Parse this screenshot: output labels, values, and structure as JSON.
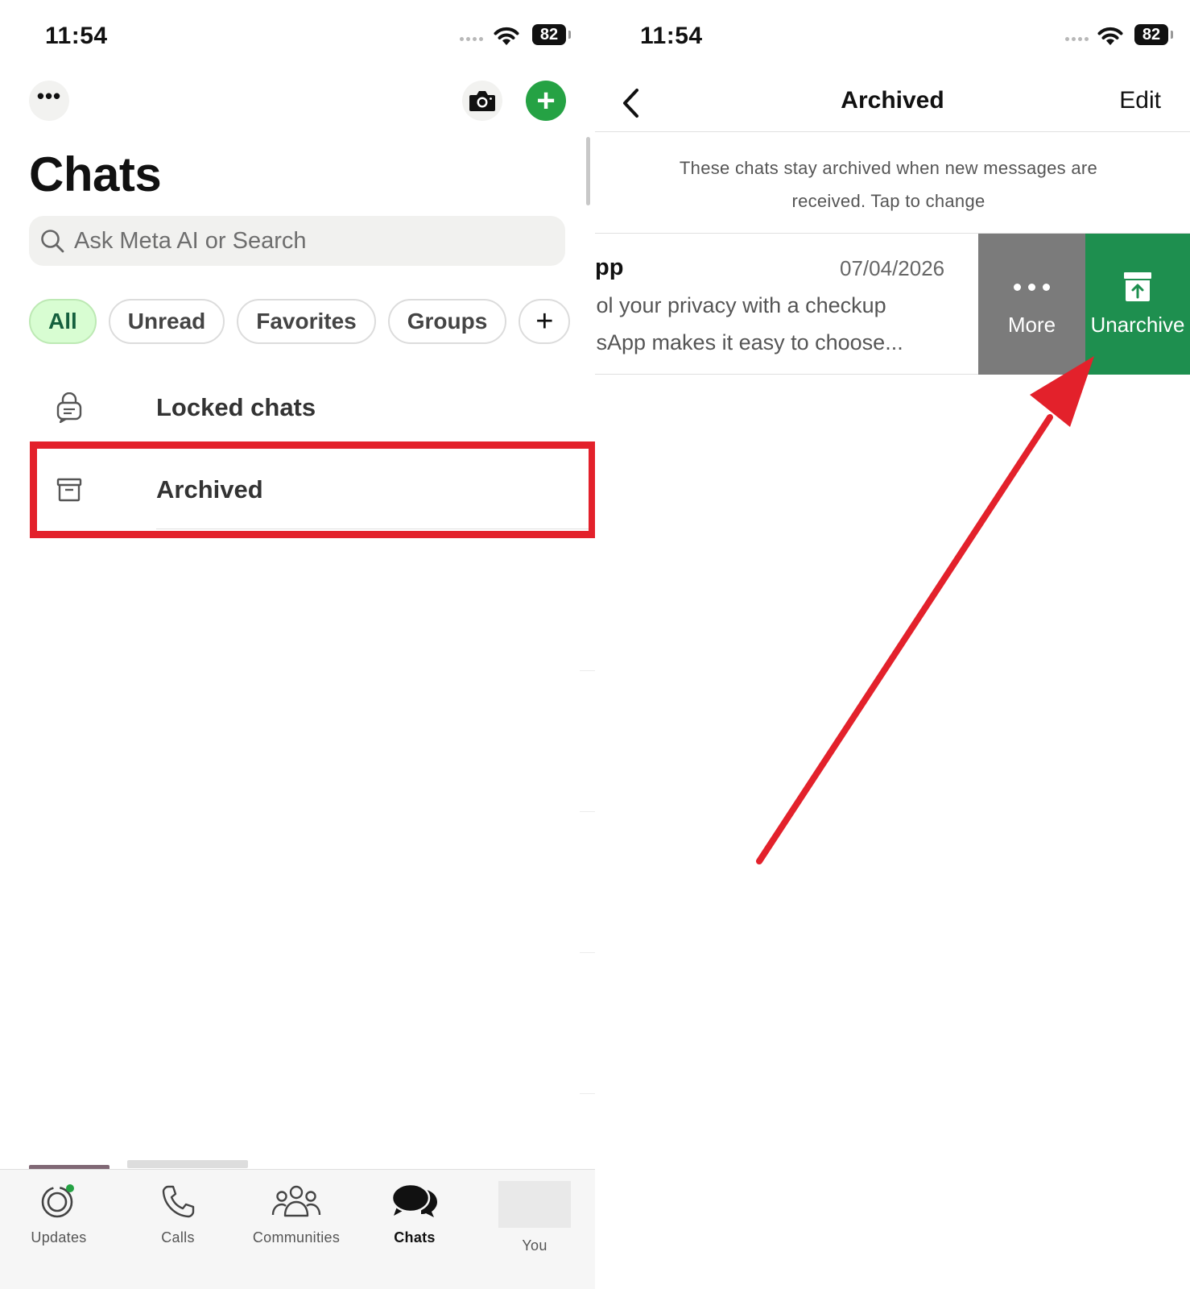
{
  "left_screen": {
    "status_bar": {
      "time": "11:54",
      "battery": "82"
    },
    "header": {
      "more_icon": "ellipsis-icon",
      "more_label": "•••",
      "camera_icon": "camera-icon",
      "new_chat_icon": "plus-icon",
      "new_chat_label": "+"
    },
    "title": "Chats",
    "search": {
      "placeholder": "Ask Meta AI or Search",
      "icon": "search-icon"
    },
    "filters": [
      "All",
      "Unread",
      "Favorites",
      "Groups"
    ],
    "filter_active": "All",
    "filter_add_label": "+",
    "rows": {
      "locked": {
        "label": "Locked chats",
        "icon": "locked-chat-icon"
      },
      "archived": {
        "label": "Archived",
        "icon": "archive-box-icon"
      }
    },
    "tabbar": {
      "tabs": [
        {
          "label": "Updates",
          "icon": "updates-icon"
        },
        {
          "label": "Calls",
          "icon": "phone-icon"
        },
        {
          "label": "Communities",
          "icon": "communities-icon"
        },
        {
          "label": "Chats",
          "icon": "chats-icon"
        },
        {
          "label": "You",
          "icon": "avatar"
        }
      ],
      "active": "Chats"
    }
  },
  "right_screen": {
    "status_bar": {
      "time": "11:54",
      "battery": "82"
    },
    "nav": {
      "back_icon": "chevron-left-icon",
      "title": "Archived",
      "edit_label": "Edit"
    },
    "notice_line1": "These chats stay archived when new messages are",
    "notice_line2": "received. Tap to change",
    "chat": {
      "name": "ıpp",
      "date": "07/04/2026",
      "preview_line1": "ıol your privacy with a checkup",
      "preview_line2": "ısApp makes it easy to choose..."
    },
    "swipe_actions": {
      "more_label": "More",
      "unarchive_label": "Unarchive"
    }
  },
  "annotation": {
    "highlight_color": "#e3212b",
    "arrow_color": "#e3212b"
  },
  "colors": {
    "accent_green": "#25a244",
    "unarchive_green": "#1e8f4f",
    "more_gray": "#7b7b7b",
    "chip_active_bg": "#d8fdd2"
  }
}
